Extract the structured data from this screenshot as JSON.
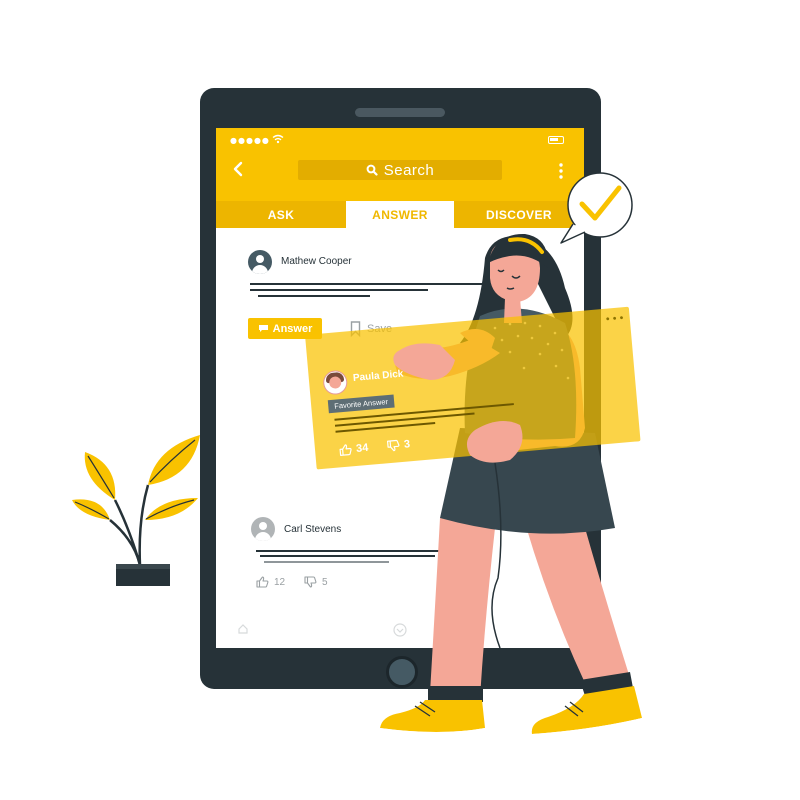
{
  "app": {
    "search_label": "Search",
    "tabs": [
      {
        "label": "ASK",
        "active": false
      },
      {
        "label": "ANSWER",
        "active": true
      },
      {
        "label": "DISCOVER",
        "active": false
      }
    ],
    "accent_color": "#f9c200"
  },
  "feed": {
    "post1": {
      "author": "Mathew Cooper",
      "answer_label": "Answer",
      "save_label": "Save"
    },
    "post2": {
      "author": "Carl Stevens",
      "likes": "12",
      "dislikes": "5"
    }
  },
  "answer_card": {
    "author": "Paula Dick",
    "badge": "Favorite Answer",
    "likes": "34",
    "dislikes": "3"
  },
  "icons": {
    "back": "chevron-left-icon",
    "search": "search-icon",
    "more": "more-vertical-icon",
    "save": "bookmark-icon",
    "like": "thumbs-up-icon",
    "dislike": "thumbs-down-icon",
    "check": "check-icon"
  }
}
